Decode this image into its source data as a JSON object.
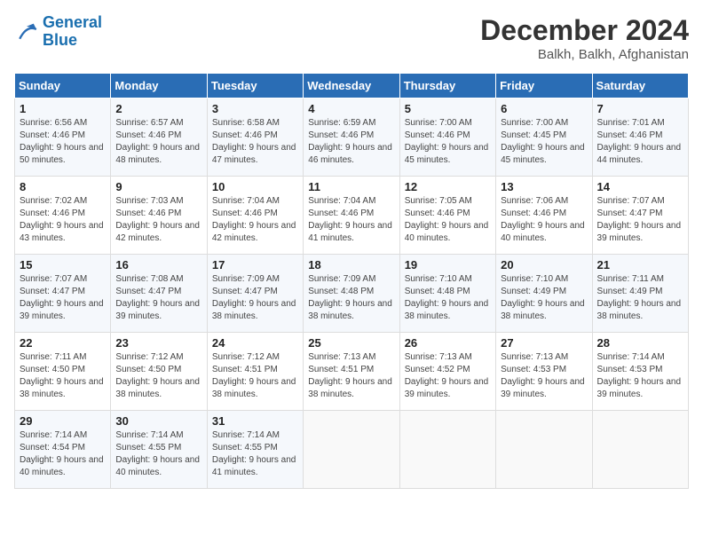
{
  "logo": {
    "line1": "General",
    "line2": "Blue"
  },
  "title": "December 2024",
  "subtitle": "Balkh, Balkh, Afghanistan",
  "weekdays": [
    "Sunday",
    "Monday",
    "Tuesday",
    "Wednesday",
    "Thursday",
    "Friday",
    "Saturday"
  ],
  "weeks": [
    [
      {
        "day": "1",
        "sunrise": "Sunrise: 6:56 AM",
        "sunset": "Sunset: 4:46 PM",
        "daylight": "Daylight: 9 hours and 50 minutes."
      },
      {
        "day": "2",
        "sunrise": "Sunrise: 6:57 AM",
        "sunset": "Sunset: 4:46 PM",
        "daylight": "Daylight: 9 hours and 48 minutes."
      },
      {
        "day": "3",
        "sunrise": "Sunrise: 6:58 AM",
        "sunset": "Sunset: 4:46 PM",
        "daylight": "Daylight: 9 hours and 47 minutes."
      },
      {
        "day": "4",
        "sunrise": "Sunrise: 6:59 AM",
        "sunset": "Sunset: 4:46 PM",
        "daylight": "Daylight: 9 hours and 46 minutes."
      },
      {
        "day": "5",
        "sunrise": "Sunrise: 7:00 AM",
        "sunset": "Sunset: 4:46 PM",
        "daylight": "Daylight: 9 hours and 45 minutes."
      },
      {
        "day": "6",
        "sunrise": "Sunrise: 7:00 AM",
        "sunset": "Sunset: 4:45 PM",
        "daylight": "Daylight: 9 hours and 45 minutes."
      },
      {
        "day": "7",
        "sunrise": "Sunrise: 7:01 AM",
        "sunset": "Sunset: 4:46 PM",
        "daylight": "Daylight: 9 hours and 44 minutes."
      }
    ],
    [
      {
        "day": "8",
        "sunrise": "Sunrise: 7:02 AM",
        "sunset": "Sunset: 4:46 PM",
        "daylight": "Daylight: 9 hours and 43 minutes."
      },
      {
        "day": "9",
        "sunrise": "Sunrise: 7:03 AM",
        "sunset": "Sunset: 4:46 PM",
        "daylight": "Daylight: 9 hours and 42 minutes."
      },
      {
        "day": "10",
        "sunrise": "Sunrise: 7:04 AM",
        "sunset": "Sunset: 4:46 PM",
        "daylight": "Daylight: 9 hours and 42 minutes."
      },
      {
        "day": "11",
        "sunrise": "Sunrise: 7:04 AM",
        "sunset": "Sunset: 4:46 PM",
        "daylight": "Daylight: 9 hours and 41 minutes."
      },
      {
        "day": "12",
        "sunrise": "Sunrise: 7:05 AM",
        "sunset": "Sunset: 4:46 PM",
        "daylight": "Daylight: 9 hours and 40 minutes."
      },
      {
        "day": "13",
        "sunrise": "Sunrise: 7:06 AM",
        "sunset": "Sunset: 4:46 PM",
        "daylight": "Daylight: 9 hours and 40 minutes."
      },
      {
        "day": "14",
        "sunrise": "Sunrise: 7:07 AM",
        "sunset": "Sunset: 4:47 PM",
        "daylight": "Daylight: 9 hours and 39 minutes."
      }
    ],
    [
      {
        "day": "15",
        "sunrise": "Sunrise: 7:07 AM",
        "sunset": "Sunset: 4:47 PM",
        "daylight": "Daylight: 9 hours and 39 minutes."
      },
      {
        "day": "16",
        "sunrise": "Sunrise: 7:08 AM",
        "sunset": "Sunset: 4:47 PM",
        "daylight": "Daylight: 9 hours and 39 minutes."
      },
      {
        "day": "17",
        "sunrise": "Sunrise: 7:09 AM",
        "sunset": "Sunset: 4:47 PM",
        "daylight": "Daylight: 9 hours and 38 minutes."
      },
      {
        "day": "18",
        "sunrise": "Sunrise: 7:09 AM",
        "sunset": "Sunset: 4:48 PM",
        "daylight": "Daylight: 9 hours and 38 minutes."
      },
      {
        "day": "19",
        "sunrise": "Sunrise: 7:10 AM",
        "sunset": "Sunset: 4:48 PM",
        "daylight": "Daylight: 9 hours and 38 minutes."
      },
      {
        "day": "20",
        "sunrise": "Sunrise: 7:10 AM",
        "sunset": "Sunset: 4:49 PM",
        "daylight": "Daylight: 9 hours and 38 minutes."
      },
      {
        "day": "21",
        "sunrise": "Sunrise: 7:11 AM",
        "sunset": "Sunset: 4:49 PM",
        "daylight": "Daylight: 9 hours and 38 minutes."
      }
    ],
    [
      {
        "day": "22",
        "sunrise": "Sunrise: 7:11 AM",
        "sunset": "Sunset: 4:50 PM",
        "daylight": "Daylight: 9 hours and 38 minutes."
      },
      {
        "day": "23",
        "sunrise": "Sunrise: 7:12 AM",
        "sunset": "Sunset: 4:50 PM",
        "daylight": "Daylight: 9 hours and 38 minutes."
      },
      {
        "day": "24",
        "sunrise": "Sunrise: 7:12 AM",
        "sunset": "Sunset: 4:51 PM",
        "daylight": "Daylight: 9 hours and 38 minutes."
      },
      {
        "day": "25",
        "sunrise": "Sunrise: 7:13 AM",
        "sunset": "Sunset: 4:51 PM",
        "daylight": "Daylight: 9 hours and 38 minutes."
      },
      {
        "day": "26",
        "sunrise": "Sunrise: 7:13 AM",
        "sunset": "Sunset: 4:52 PM",
        "daylight": "Daylight: 9 hours and 39 minutes."
      },
      {
        "day": "27",
        "sunrise": "Sunrise: 7:13 AM",
        "sunset": "Sunset: 4:53 PM",
        "daylight": "Daylight: 9 hours and 39 minutes."
      },
      {
        "day": "28",
        "sunrise": "Sunrise: 7:14 AM",
        "sunset": "Sunset: 4:53 PM",
        "daylight": "Daylight: 9 hours and 39 minutes."
      }
    ],
    [
      {
        "day": "29",
        "sunrise": "Sunrise: 7:14 AM",
        "sunset": "Sunset: 4:54 PM",
        "daylight": "Daylight: 9 hours and 40 minutes."
      },
      {
        "day": "30",
        "sunrise": "Sunrise: 7:14 AM",
        "sunset": "Sunset: 4:55 PM",
        "daylight": "Daylight: 9 hours and 40 minutes."
      },
      {
        "day": "31",
        "sunrise": "Sunrise: 7:14 AM",
        "sunset": "Sunset: 4:55 PM",
        "daylight": "Daylight: 9 hours and 41 minutes."
      },
      null,
      null,
      null,
      null
    ]
  ]
}
